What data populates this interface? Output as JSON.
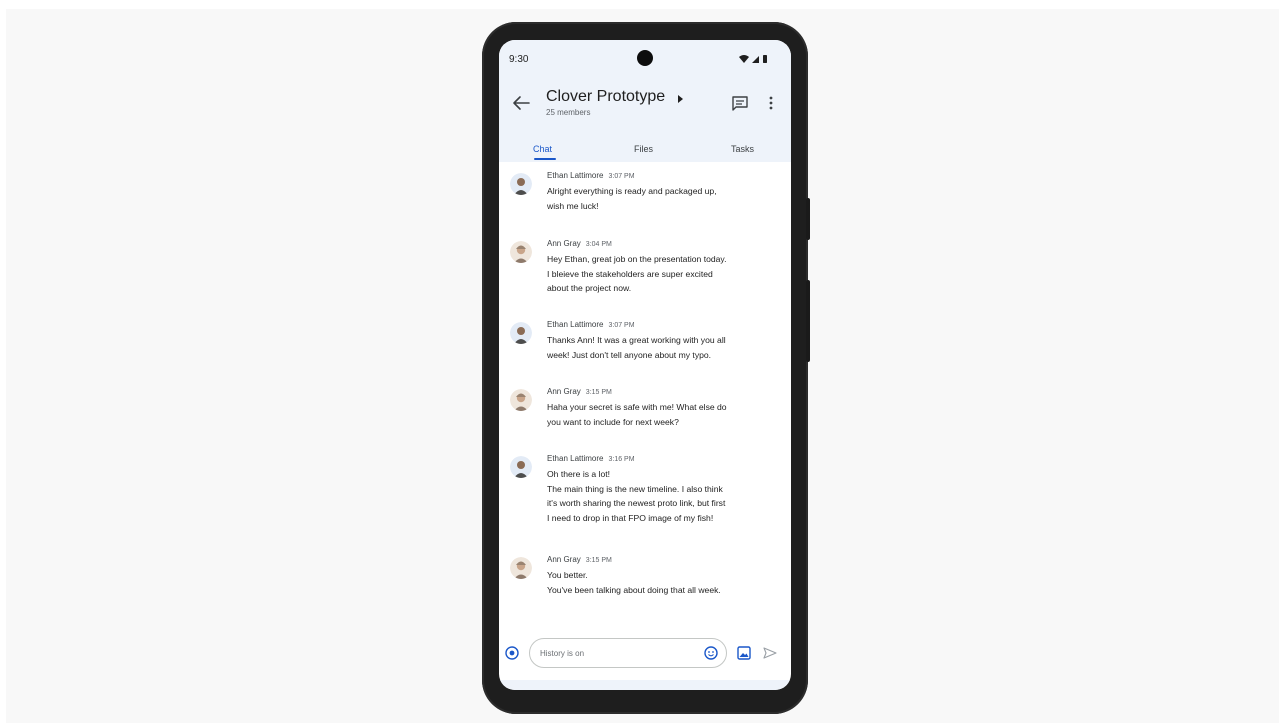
{
  "status_bar": {
    "time": "9:30"
  },
  "header": {
    "title": "Clover Prototype",
    "subtitle": "25 members"
  },
  "tabs": [
    {
      "label": "Chat",
      "active": true
    },
    {
      "label": "Files",
      "active": false
    },
    {
      "label": "Tasks",
      "active": false
    }
  ],
  "messages": [
    {
      "sender": "Ethan Lattimore",
      "time": "3:07 PM",
      "avatar": "ethan-avatar",
      "lines": [
        "Alright everything is ready and packaged up,",
        "wish me luck!"
      ]
    },
    {
      "sender": "Ann Gray",
      "time": "3:04 PM",
      "avatar": "ann-avatar",
      "lines": [
        "Hey Ethan, great job on the presentation today.",
        "I bleieve the stakeholders are super excited",
        "about the project now."
      ]
    },
    {
      "sender": "Ethan Lattimore",
      "time": "3:07 PM",
      "avatar": "ethan-avatar",
      "lines": [
        "Thanks Ann! It was a great working with you all",
        "week! Just don't tell anyone about my typo."
      ]
    },
    {
      "sender": "Ann Gray",
      "time": "3:15 PM",
      "avatar": "ann-avatar",
      "lines": [
        "Haha your secret is safe with me! What else do",
        "you want to include for next week?"
      ]
    },
    {
      "sender": "Ethan Lattimore",
      "time": "3:16 PM",
      "avatar": "ethan-avatar",
      "lines": [
        "Oh there is a lot!",
        "The main thing is the new timeline. I also think",
        "it's worth sharing the newest proto link, but first",
        "I need to drop in that FPO image of my fish!"
      ]
    },
    {
      "sender": "Ann Gray",
      "time": "3:15 PM",
      "avatar": "ann-avatar",
      "lines": [
        "You better.",
        "You've been talking about doing that all week."
      ]
    }
  ],
  "compose": {
    "placeholder": "History is on"
  },
  "colors": {
    "accent": "#1a57c9",
    "header_bg": "#eef3fa",
    "phone_frame": "#1e1e1e"
  }
}
